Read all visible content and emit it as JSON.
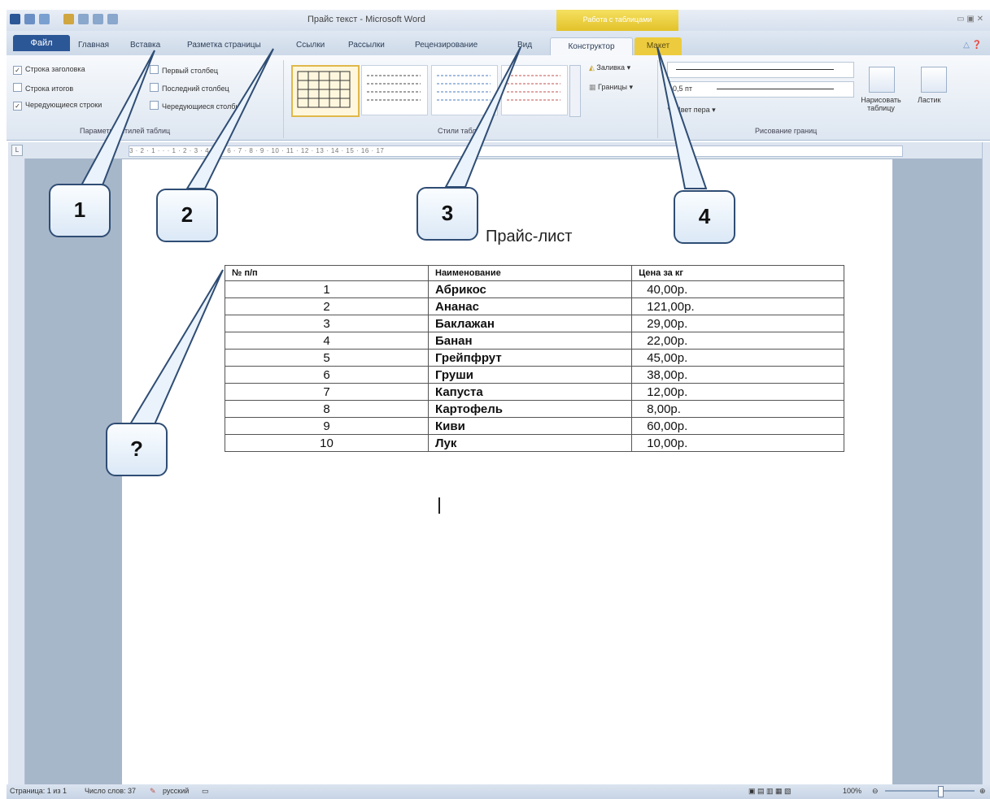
{
  "titlebar": {
    "title": "Прайс текст - Microsoft Word",
    "context_tab": "Работа с таблицами",
    "window_controls": "▭ ▣ ✕"
  },
  "tabs": {
    "file": "Файл",
    "items": [
      "Главная",
      "Вставка",
      "Разметка страницы",
      "Ссылки",
      "Рассылки",
      "Рецензирование",
      "Вид"
    ],
    "design": "Конструктор",
    "layout": "Макет",
    "help_icons": "△ ❓"
  },
  "ribbon": {
    "options": {
      "header_row": "Строка заголовка",
      "total_row": "Строка итогов",
      "banded_rows": "Чередующиеся строки",
      "first_column": "Первый столбец",
      "last_column": "Последний столбец",
      "banded_columns": "Чередующиеся столбцы",
      "group_label": "Параметры стилей таблиц"
    },
    "styles_group_label": "Стили таблиц",
    "shading": "Заливка ▾",
    "borders": "Границы ▾",
    "pen_weight": "0,5 пт",
    "pen_color": "Цвет пера ▾",
    "draw_table": "Нарисовать таблицу",
    "eraser": "Ластик",
    "draw_group_label": "Рисование границ"
  },
  "ruler": {
    "text": "3 · 2 · 1 · · · 1 · 2 · 3 · 4 · 5 · 6 · 7 · 8 · 9 · 10 · 11 · 12 · 13 · 14 · 15 · 16 · 17",
    "corner": "L"
  },
  "document": {
    "title": "Прайс-лист",
    "table": {
      "headers": [
        "№ п/п",
        "Наименование",
        "Цена за кг"
      ],
      "rows": [
        [
          "1",
          "Абрикос",
          "40,00р."
        ],
        [
          "2",
          "Ананас",
          "121,00р."
        ],
        [
          "3",
          "Баклажан",
          "29,00р."
        ],
        [
          "4",
          "Банан",
          "22,00р."
        ],
        [
          "5",
          "Грейпфрут",
          "45,00р."
        ],
        [
          "6",
          "Груши",
          "38,00р."
        ],
        [
          "7",
          "Капуста",
          "12,00р."
        ],
        [
          "8",
          "Картофель",
          "8,00р."
        ],
        [
          "9",
          "Киви",
          "60,00р."
        ],
        [
          "10",
          "Лук",
          "10,00р."
        ]
      ]
    }
  },
  "statusbar": {
    "page": "Страница: 1 из 1",
    "words": "Число слов: 37",
    "language": "русский",
    "zoom": "100%"
  },
  "callouts": [
    "1",
    "2",
    "3",
    "4",
    "?"
  ],
  "colors": {
    "file_tab": "#2b5797",
    "context_tab": "#e3c22a",
    "callout_border": "#2f4d74"
  }
}
